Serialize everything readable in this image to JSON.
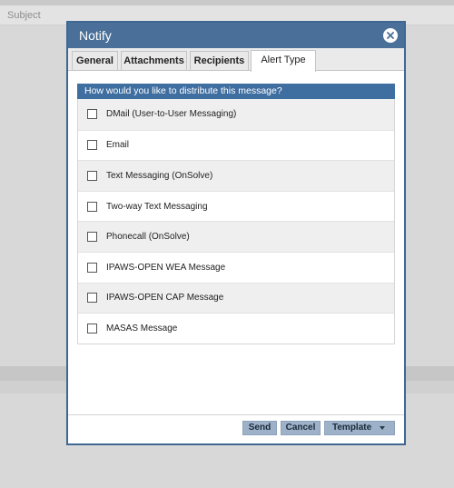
{
  "background": {
    "subject_label": "Subject"
  },
  "dialog": {
    "title": "Notify",
    "tabs": [
      {
        "label": "General"
      },
      {
        "label": "Attachments"
      },
      {
        "label": "Recipients"
      },
      {
        "label": "Alert Type"
      }
    ],
    "active_tab": "Alert Type",
    "question": "How would you like to distribute this message?",
    "options": [
      {
        "label": "DMail (User-to-User Messaging)",
        "checked": false
      },
      {
        "label": "Email",
        "checked": false
      },
      {
        "label": "Text Messaging (OnSolve)",
        "checked": false
      },
      {
        "label": "Two-way Text Messaging",
        "checked": false
      },
      {
        "label": "Phonecall (OnSolve)",
        "checked": false
      },
      {
        "label": "IPAWS-OPEN WEA Message",
        "checked": false
      },
      {
        "label": "IPAWS-OPEN CAP Message",
        "checked": false
      },
      {
        "label": "MASAS Message",
        "checked": false
      }
    ],
    "buttons": {
      "send": "Send",
      "cancel": "Cancel",
      "template": "Template"
    }
  },
  "colors": {
    "header": "#4a7099",
    "panel_header": "#3f6ea0",
    "button": "#9db1c8"
  }
}
